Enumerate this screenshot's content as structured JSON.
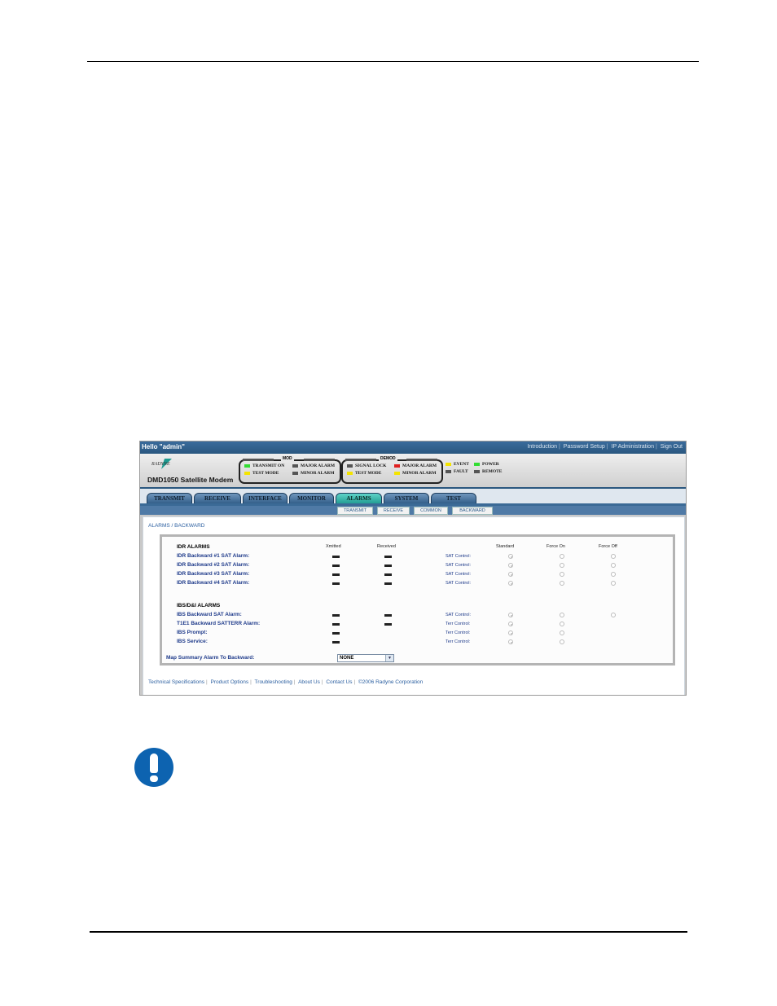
{
  "topbar": {
    "greeting": "Hello \"admin\"",
    "links": [
      "Introduction",
      "Password Setup",
      "IP Administration",
      "Sign Out"
    ]
  },
  "header": {
    "logo_text": "RADYNE",
    "model": "DMD1050 Satellite Modem",
    "mod_title": "MOD",
    "demod_title": "DEMOD",
    "leds": {
      "transmit_on": "TRANSMIT ON",
      "test_mode_mod": "TEST MODE",
      "major_alarm_mod": "MAJOR ALARM",
      "minor_alarm_mod": "MINOR ALARM",
      "signal_lock": "SIGNAL LOCK",
      "test_mode_demod": "TEST MODE",
      "major_alarm_demod": "MAJOR ALARM",
      "minor_alarm_demod": "MINOR ALARM",
      "event": "EVENT",
      "fault": "FAULT",
      "power": "POWER",
      "remote": "REMOTE"
    },
    "colors": {
      "green": "#33dd33",
      "yellow": "#f4e400",
      "red": "#e02020",
      "gray": "#555555"
    }
  },
  "tabs": [
    "TRANSMIT",
    "RECEIVE",
    "INTERFACE",
    "MONITOR",
    "ALARMS",
    "SYSTEM",
    "TEST"
  ],
  "active_tab": "ALARMS",
  "subtabs": [
    "TRANSMIT",
    "RECEIVE",
    "COMMON",
    "BACKWARD"
  ],
  "breadcrumb": "ALARMS / BACKWARD",
  "panel": {
    "idr_title": "IDR ALARMS",
    "col_xmitted": "Xmitted",
    "col_received": "Received",
    "col_standard": "Standard",
    "col_force_on": "Force On",
    "col_force_off": "Force Off",
    "idr_rows": [
      {
        "label": "IDR Backward #1 SAT Alarm:",
        "control": "SAT Control:"
      },
      {
        "label": "IDR Backward #2 SAT Alarm:",
        "control": "SAT Control:"
      },
      {
        "label": "IDR Backward #3 SAT Alarm:",
        "control": "SAT Control:"
      },
      {
        "label": "IDR Backward #4 SAT Alarm:",
        "control": "SAT Control:"
      }
    ],
    "ibs_title": "IBS/D&I ALARMS",
    "ibs_rows": [
      {
        "label": "IBS Backward SAT Alarm:",
        "control": "SAT Control:"
      },
      {
        "label": "T1E1 Backward SATTERR Alarm:",
        "control": "Terr Control:"
      },
      {
        "label": "IBS Prompt:",
        "control": "Terr Control:"
      },
      {
        "label": "IBS Service:",
        "control": "Terr Control:"
      }
    ],
    "map_label": "Map Summary Alarm To Backward:",
    "map_value": "NONE"
  },
  "footer": [
    "Technical Specifications",
    "Product Options",
    "Troubleshooting",
    "About Us",
    "Contact Us",
    "©2006 Radyne Corporation"
  ]
}
